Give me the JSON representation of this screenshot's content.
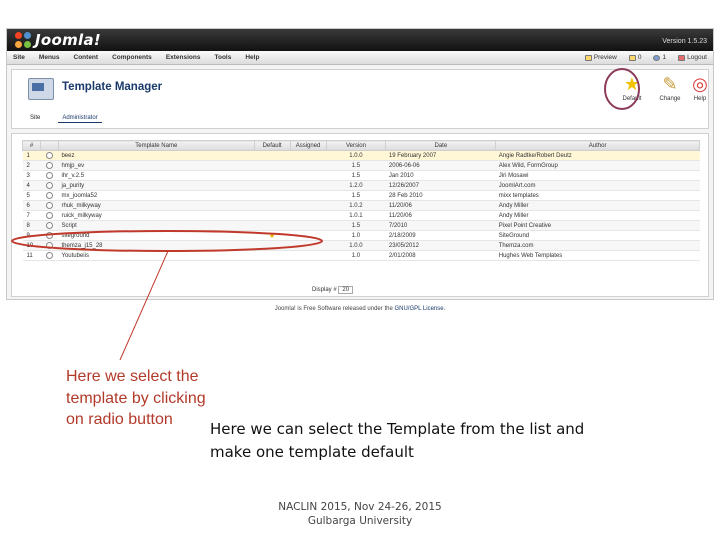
{
  "app": {
    "logo_text": "Joomla!",
    "version": "Version 1.5.23"
  },
  "menu": {
    "items": [
      "Site",
      "Menus",
      "Content",
      "Components",
      "Extensions",
      "Tools",
      "Help"
    ],
    "status": {
      "preview": "Preview",
      "messages": "0",
      "users": "1",
      "logout": "Logout"
    }
  },
  "toolbar": {
    "title": "Template Manager",
    "buttons": {
      "default": "Default",
      "change": "Change",
      "help": "Help"
    }
  },
  "tabs": [
    "Site",
    "Administrator"
  ],
  "table": {
    "headers": [
      "#",
      "",
      "Template Name",
      "Default",
      "Assigned",
      "Version",
      "Date",
      "Author"
    ],
    "rows": [
      {
        "num": "1",
        "name": "beez",
        "default": "",
        "version": "1.0.0",
        "date": "19 February 2007",
        "author": "Angie Radtke/Robert Deutz"
      },
      {
        "num": "2",
        "name": "hmjp_ev",
        "default": "",
        "version": "1.5",
        "date": "2006-06-06",
        "author": "Alex Wild, FormGroup"
      },
      {
        "num": "3",
        "name": "ihr_v.2.5",
        "default": "",
        "version": "1.5",
        "date": "Jan 2010",
        "author": "Jiri Mosawi"
      },
      {
        "num": "4",
        "name": "ja_purity",
        "default": "",
        "version": "1.2.0",
        "date": "12/26/2007",
        "author": "JoomlArt.com"
      },
      {
        "num": "5",
        "name": "mx_joomla52",
        "default": "",
        "version": "1.5",
        "date": "28 Feb 2010",
        "author": "mixx templates"
      },
      {
        "num": "6",
        "name": "rhuk_milkyway",
        "default": "",
        "version": "1.0.2",
        "date": "11/20/06",
        "author": "Andy Miller"
      },
      {
        "num": "7",
        "name": "ruick_milkyway",
        "default": "",
        "version": "1.0.1",
        "date": "11/20/06",
        "author": "Andy Miller"
      },
      {
        "num": "8",
        "name": "Script",
        "default": "",
        "version": "1.5",
        "date": "7/2010",
        "author": "Pixel Point Creative"
      },
      {
        "num": "9",
        "name": "siteground",
        "default": "★",
        "version": "1.0",
        "date": "2/18/2009",
        "author": "SiteGround"
      },
      {
        "num": "10",
        "name": "themza_j15_28",
        "default": "",
        "version": "1.0.0",
        "date": "23/05/2012",
        "author": "Themza.com"
      },
      {
        "num": "11",
        "name": "Youtubeiis",
        "default": "",
        "version": "1.0",
        "date": "2/01/2008",
        "author": "Hughes Web Templates"
      }
    ],
    "display_label": "Display #",
    "display_value": "20"
  },
  "footer_note": {
    "prefix": "Joomla! is Free Software released under the",
    "license": "GNU/GPL License."
  },
  "annotations": {
    "left_callout": "Here we select the template by clicking on radio button",
    "main_callout": "Here we can select the Template from the list and make one template default"
  },
  "credit": {
    "line1": "NACLIN 2015, Nov 24-26, 2015",
    "line2": "Gulbarga University"
  },
  "colors": {
    "annotation": "#b23a2a",
    "title": "#1a3a6b",
    "highlight_row": "#fff7d6"
  }
}
